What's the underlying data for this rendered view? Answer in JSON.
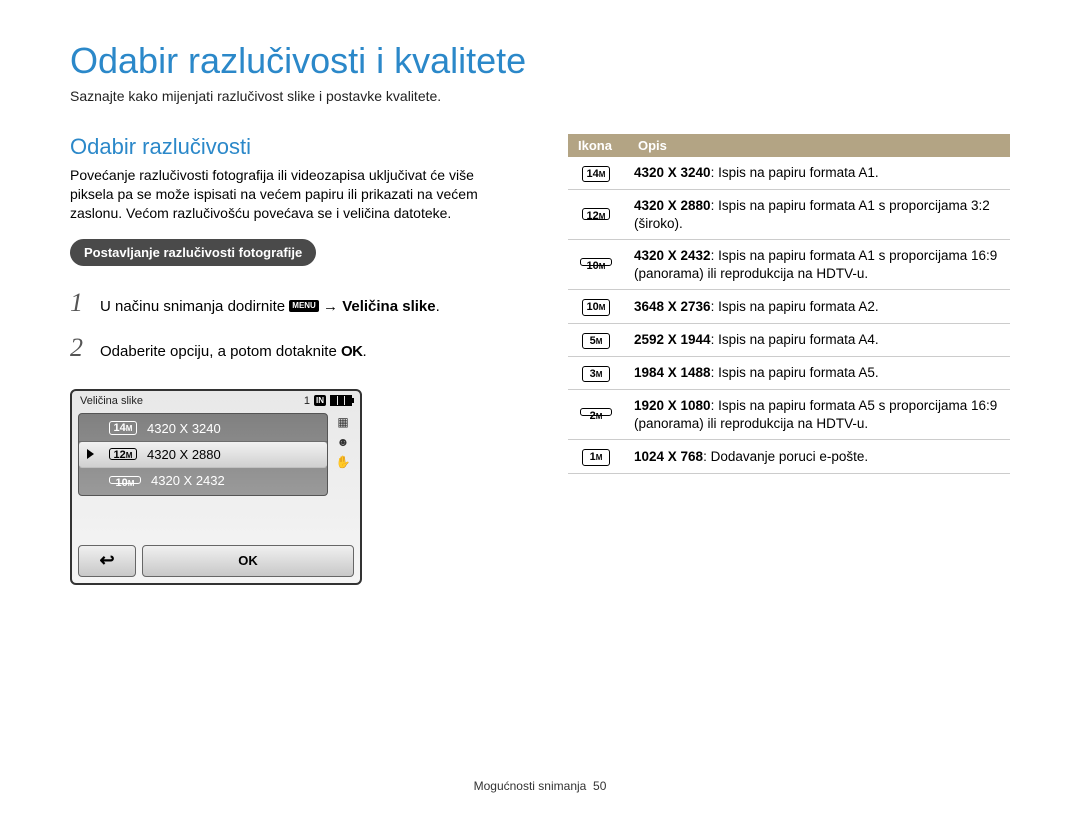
{
  "title": "Odabir razlučivosti i kvalitete",
  "subtitle": "Saznajte kako mijenjati razlučivost slike i postavke kvalitete.",
  "section_heading": "Odabir razlučivosti",
  "body_text": "Povećanje razlučivosti fotografija ili videozapisa uključivat će više piksela pa se može ispisati na većem papiru ili prikazati na većem zaslonu. Većom razlučivošću povećava se i veličina datoteke.",
  "pill_label": "Postavljanje razlučivosti fotografije",
  "steps": {
    "s1_num": "1",
    "s1_a": "U načinu snimanja dodirnite ",
    "s1_menu": "MENU",
    "s1_b": " → ",
    "s1_c": "Veličina slike",
    "s1_d": ".",
    "s2_num": "2",
    "s2_a": "Odaberite opciju, a potom dotaknite ",
    "s2_ok": "OK",
    "s2_b": "."
  },
  "camera": {
    "title": "Veličina slike",
    "counter": "1",
    "in_label": "IN",
    "rows": [
      {
        "badge_big": "14",
        "text": "4320 X 3240",
        "selected": false,
        "shape": "normal"
      },
      {
        "badge_big": "12",
        "text": "4320 X 2880",
        "selected": true,
        "shape": "wide"
      },
      {
        "badge_big": "10",
        "text": "4320 X 2432",
        "selected": false,
        "shape": "pano"
      }
    ],
    "ok_label": "OK"
  },
  "table": {
    "h1": "Ikona",
    "h2": "Opis",
    "rows": [
      {
        "big": "14",
        "shape": "normal",
        "bold": "4320 X 3240",
        "rest": ": Ispis na papiru formata A1."
      },
      {
        "big": "12",
        "shape": "wide",
        "bold": "4320 X 2880",
        "rest": ": Ispis na papiru formata A1 s proporcijama 3:2 (široko)."
      },
      {
        "big": "10",
        "shape": "pano",
        "bold": "4320 X 2432",
        "rest": ": Ispis na papiru formata A1 s proporcijama 16:9 (panorama) ili reprodukcija na HDTV-u."
      },
      {
        "big": "10",
        "shape": "normal",
        "bold": "3648 X 2736",
        "rest": ": Ispis na papiru formata A2."
      },
      {
        "big": "5",
        "shape": "normal",
        "bold": "2592 X 1944",
        "rest": ": Ispis na papiru formata A4."
      },
      {
        "big": "3",
        "shape": "normal",
        "bold": "1984 X 1488",
        "rest": ": Ispis na papiru formata A5."
      },
      {
        "big": "2",
        "shape": "pano",
        "bold": "1920 X 1080",
        "rest": ": Ispis na papiru formata A5 s proporcijama 16:9 (panorama) ili reprodukcija na HDTV-u."
      },
      {
        "big": "1",
        "shape": "normal",
        "bold": "1024 X 768",
        "rest": ": Dodavanje poruci e-pošte."
      }
    ]
  },
  "footer_label": "Mogućnosti snimanja",
  "footer_page": "50"
}
